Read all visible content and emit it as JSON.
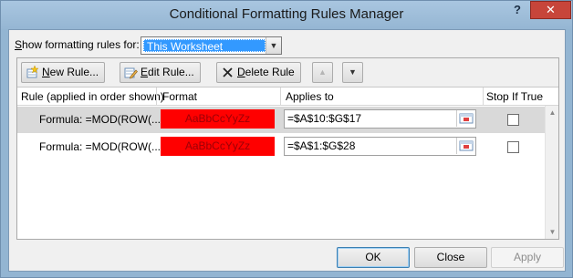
{
  "window": {
    "title": "Conditional Formatting Rules Manager",
    "help_glyph": "?",
    "close_glyph": "✕"
  },
  "scope": {
    "label_prefix": "S",
    "label_rest": "how formatting rules for:",
    "selected": "This Worksheet"
  },
  "toolbar": {
    "new_rule": {
      "hotkey": "N",
      "rest": "ew Rule..."
    },
    "edit_rule": {
      "hotkey": "E",
      "rest": "dit Rule..."
    },
    "delete_rule": {
      "hotkey": "D",
      "rest": "elete Rule"
    }
  },
  "columns": {
    "rule": "Rule (applied in order shown)",
    "format": "Format",
    "applies_to": "Applies to",
    "stop_if_true": "Stop If True"
  },
  "rules": [
    {
      "rule": "Formula: =MOD(ROW(...",
      "preview": "AaBbCcYyZz",
      "applies_to": "=$A$10:$G$17",
      "stop_if_true": false,
      "selected": true
    },
    {
      "rule": "Formula: =MOD(ROW(...",
      "preview": "AaBbCcYyZz",
      "applies_to": "=$A$1:$G$28",
      "stop_if_true": false,
      "selected": false
    }
  ],
  "buttons": {
    "ok": "OK",
    "close": "Close",
    "apply": "Apply"
  },
  "colors": {
    "format_fill": "#ff0000",
    "format_text": "#9c0006",
    "selection": "#3399ff"
  }
}
